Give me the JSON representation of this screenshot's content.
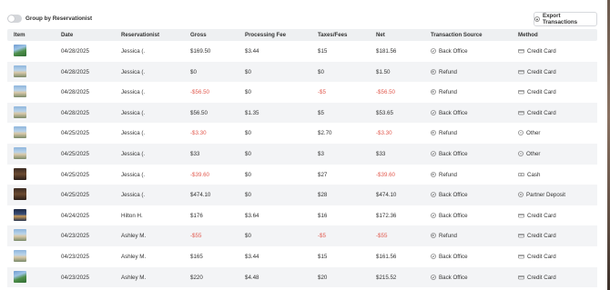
{
  "toolbar": {
    "group_toggle_label": "Group by Reservationist",
    "group_toggle_on": false,
    "export_label": "Export Transactions"
  },
  "columns": [
    "Item",
    "Date",
    "Reservationist",
    "Gross",
    "Processing Fee",
    "Taxes/Fees",
    "Net",
    "Transaction Source",
    "Method"
  ],
  "rows": [
    {
      "thumb": "pool",
      "date": "04/28/2025",
      "res": "Jessica (.",
      "gross": "$169.50",
      "fee": "$3.44",
      "tax": "$15",
      "net": "$181.56",
      "source": "Back Office",
      "source_icon": "check-circle-icon",
      "method": "Credit Card",
      "method_icon": "credit-card-icon"
    },
    {
      "thumb": "building",
      "date": "04/28/2025",
      "res": "Jessica (.",
      "gross": "$0",
      "fee": "$0",
      "tax": "$0",
      "net": "$1.50",
      "source": "Refund",
      "source_icon": "refund-icon",
      "method": "Credit Card",
      "method_icon": "credit-card-icon"
    },
    {
      "thumb": "building",
      "date": "04/28/2025",
      "res": "Jessica (.",
      "gross": "-$56.50",
      "fee": "$0",
      "tax": "-$5",
      "net": "-$56.50",
      "source": "Refund",
      "source_icon": "refund-icon",
      "method": "Credit Card",
      "method_icon": "credit-card-icon"
    },
    {
      "thumb": "building",
      "date": "04/28/2025",
      "res": "Jessica (.",
      "gross": "$56.50",
      "fee": "$1.35",
      "tax": "$5",
      "net": "$53.65",
      "source": "Back Office",
      "source_icon": "check-circle-icon",
      "method": "Credit Card",
      "method_icon": "credit-card-icon"
    },
    {
      "thumb": "building",
      "date": "04/25/2025",
      "res": "Jessica (.",
      "gross": "-$3.30",
      "fee": "$0",
      "tax": "$2.70",
      "net": "-$3.30",
      "source": "Refund",
      "source_icon": "refund-icon",
      "method": "Other",
      "method_icon": "other-circle-icon"
    },
    {
      "thumb": "building",
      "date": "04/25/2025",
      "res": "Jessica (.",
      "gross": "$33",
      "fee": "$0",
      "tax": "$3",
      "net": "$33",
      "source": "Back Office",
      "source_icon": "check-circle-icon",
      "method": "Other",
      "method_icon": "other-circle-icon"
    },
    {
      "thumb": "dark",
      "date": "04/25/2025",
      "res": "Jessica (.",
      "gross": "-$39.60",
      "fee": "$0",
      "tax": "$27",
      "net": "-$39.60",
      "source": "Refund",
      "source_icon": "refund-icon",
      "method": "Cash",
      "method_icon": "cash-icon"
    },
    {
      "thumb": "dark",
      "date": "04/25/2025",
      "res": "Jessica (.",
      "gross": "$474.10",
      "fee": "$0",
      "tax": "$28",
      "net": "$474.10",
      "source": "Back Office",
      "source_icon": "check-circle-icon",
      "method": "Partner Deposit",
      "method_icon": "partner-icon"
    },
    {
      "thumb": "night",
      "date": "04/24/2025",
      "res": "Hilton H.",
      "gross": "$176",
      "fee": "$3.64",
      "tax": "$16",
      "net": "$172.36",
      "source": "Back Office",
      "source_icon": "check-circle-icon",
      "method": "Credit Card",
      "method_icon": "credit-card-icon"
    },
    {
      "thumb": "building",
      "date": "04/23/2025",
      "res": "Ashley M.",
      "gross": "-$55",
      "fee": "$0",
      "tax": "-$5",
      "net": "-$55",
      "source": "Refund",
      "source_icon": "refund-icon",
      "method": "Credit Card",
      "method_icon": "credit-card-icon"
    },
    {
      "thumb": "building",
      "date": "04/23/2025",
      "res": "Ashley M.",
      "gross": "$165",
      "fee": "$3.44",
      "tax": "$15",
      "net": "$161.56",
      "source": "Back Office",
      "source_icon": "check-circle-icon",
      "method": "Credit Card",
      "method_icon": "credit-card-icon"
    },
    {
      "thumb": "pool",
      "date": "04/23/2025",
      "res": "Ashley M.",
      "gross": "$220",
      "fee": "$4.48",
      "tax": "$20",
      "net": "$215.52",
      "source": "Back Office",
      "source_icon": "check-circle-icon",
      "method": "Credit Card",
      "method_icon": "credit-card-icon"
    }
  ],
  "colors": {
    "negative": "#e25a4f",
    "header_bg": "#eef0f2",
    "alt_row_bg": "#f3f4f6"
  }
}
